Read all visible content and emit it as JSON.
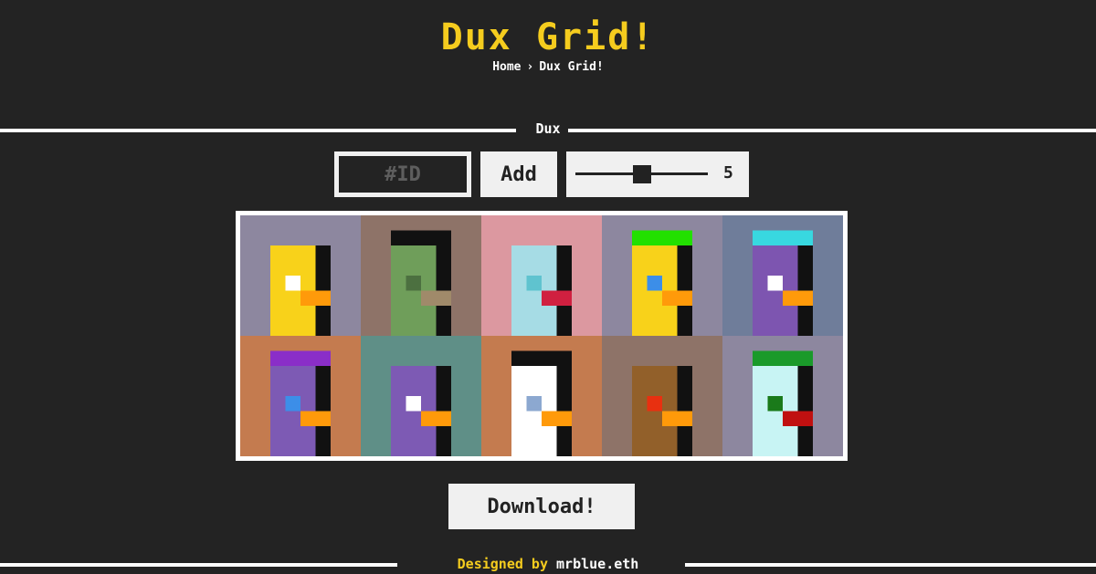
{
  "header": {
    "title": "Dux Grid!"
  },
  "breadcrumb": {
    "home": "Home",
    "separator": "›",
    "current": "Dux Grid!"
  },
  "section": {
    "label": "Dux"
  },
  "controls": {
    "id_placeholder": "#ID",
    "add_label": "Add",
    "slider_value": "5",
    "slider_fraction": 0.5
  },
  "download": {
    "label": "Download!"
  },
  "footer": {
    "prefix": "Designed by",
    "author": "mrblue.eth"
  },
  "ducks": [
    {
      "bg": "#8d879f",
      "body": "#f8d21a",
      "eye": "#ffffff",
      "beak": "#ff9a0a",
      "hat": null
    },
    {
      "bg": "#8e7368",
      "body": "#6f9e5a",
      "eye": "#4c7040",
      "beak": "#a08a6a",
      "hat": "#111111"
    },
    {
      "bg": "#dc98a0",
      "body": "#a6dce5",
      "eye": "#5fc3cf",
      "beak": "#d02040",
      "hat": null
    },
    {
      "bg": "#8d879f",
      "body": "#f8d21a",
      "eye": "#3c8ee8",
      "beak": "#ff9a0a",
      "hat": "#22e000"
    },
    {
      "bg": "#6f7d9a",
      "body": "#7d55b0",
      "eye": "#ffffff",
      "beak": "#ff9a0a",
      "hat": "#38d8e0"
    },
    {
      "bg": "#c47b4f",
      "body": "#7d5ab4",
      "eye": "#3c8ee8",
      "beak": "#ff9a0a",
      "hat": "#8a2ec8"
    },
    {
      "bg": "#5f8f87",
      "body": "#7d5ab4",
      "eye": "#ffffff",
      "beak": "#ff9a0a",
      "hat": null
    },
    {
      "bg": "#c47b4f",
      "body": "#ffffff",
      "eye": "#8ca8d0",
      "beak": "#ff9a0a",
      "hat": "#111111"
    },
    {
      "bg": "#8e7368",
      "body": "#92602a",
      "eye": "#e83010",
      "beak": "#ff9a0a",
      "hat": null
    },
    {
      "bg": "#8d879f",
      "body": "#c8f4f4",
      "eye": "#1a7a1a",
      "beak": "#c01010",
      "hat": "#1a9a2a"
    }
  ]
}
